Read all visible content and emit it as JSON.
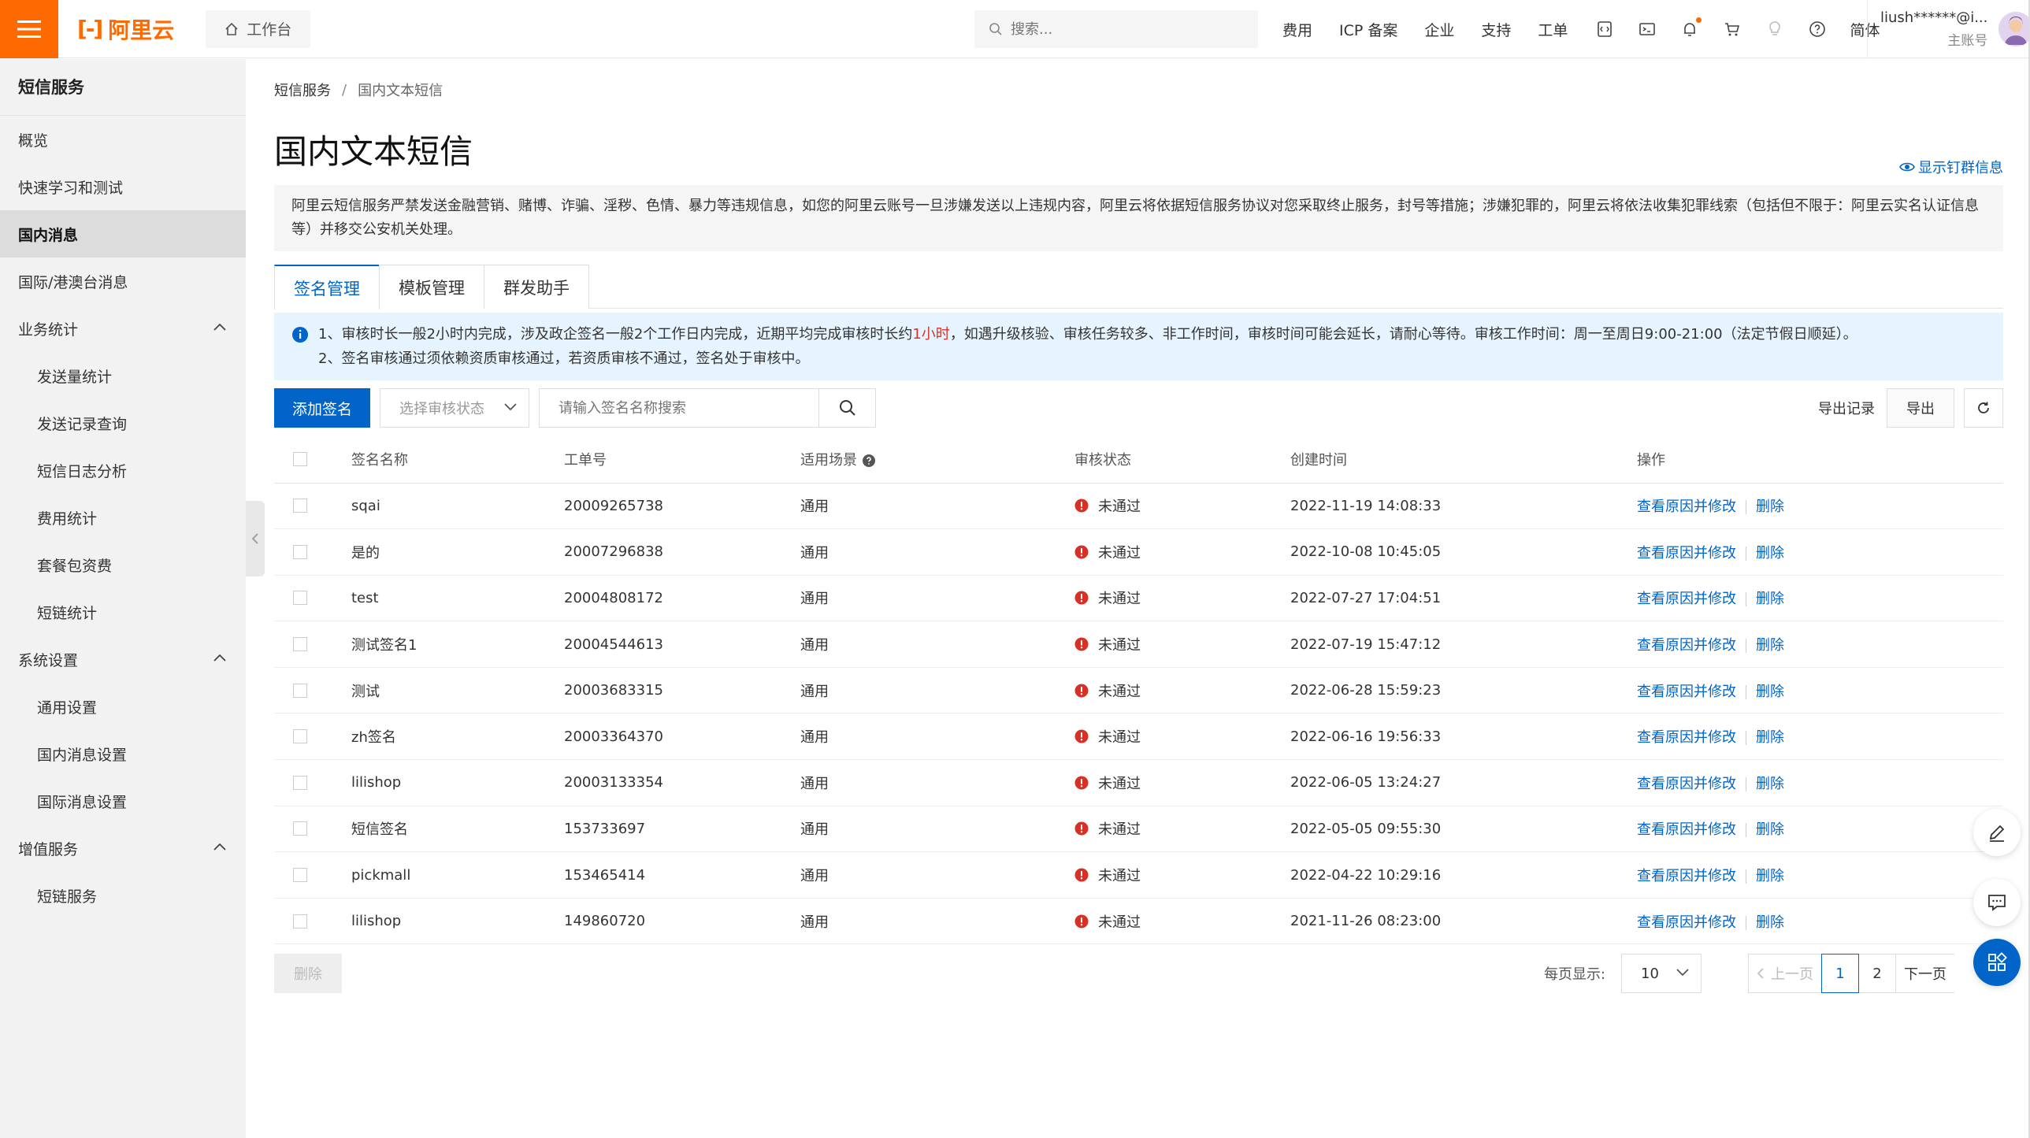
{
  "topbar": {
    "logo_text": "阿里云",
    "workbench": "工作台",
    "search_placeholder": "搜索...",
    "nav": [
      "费用",
      "ICP 备案",
      "企业",
      "支持",
      "工单"
    ],
    "lang": "简体",
    "account_name": "liush******@i...",
    "account_type": "主账号"
  },
  "sidebar": {
    "title": "短信服务",
    "items": [
      {
        "label": "概览"
      },
      {
        "label": "快速学习和测试"
      },
      {
        "label": "国内消息"
      },
      {
        "label": "国际/港澳台消息"
      },
      {
        "label": "业务统计"
      },
      {
        "label": "发送量统计"
      },
      {
        "label": "发送记录查询"
      },
      {
        "label": "短信日志分析"
      },
      {
        "label": "费用统计"
      },
      {
        "label": "套餐包资费"
      },
      {
        "label": "短链统计"
      },
      {
        "label": "系统设置"
      },
      {
        "label": "通用设置"
      },
      {
        "label": "国内消息设置"
      },
      {
        "label": "国际消息设置"
      },
      {
        "label": "增值服务"
      },
      {
        "label": "短链服务"
      }
    ]
  },
  "breadcrumb": {
    "root": "短信服务",
    "sep": "/",
    "current": "国内文本短信"
  },
  "page_title": "国内文本短信",
  "pin_link": "显示钉群信息",
  "warning": "阿里云短信服务严禁发送金融营销、赌博、诈骗、淫秽、色情、暴力等违规信息，如您的阿里云账号一旦涉嫌发送以上违规内容，阿里云将依据短信服务协议对您采取终止服务，封号等措施；涉嫌犯罪的，阿里云将依法收集犯罪线索（包括但不限于：阿里云实名认证信息等）并移交公安机关处理。",
  "tabs": [
    "签名管理",
    "模板管理",
    "群发助手"
  ],
  "notice": {
    "line1_a": "1、审核时长一般2小时内完成，涉及政企签名一般2个工作日内完成，近期平均完成审核时长约",
    "line1_red": "1小时",
    "line1_b": "，如遇升级核验、审核任务较多、非工作时间，审核时间可能会延长，请耐心等待。审核工作时间：周一至周日9:00-21:00（法定节假日顺延）。",
    "line2": "2、签名审核通过须依赖资质审核通过，若资质审核不通过，签名处于审核中。"
  },
  "toolbar": {
    "add": "添加签名",
    "status_placeholder": "选择审核状态",
    "search_placeholder": "请输入签名名称搜索",
    "export_records": "导出记录",
    "export": "导出"
  },
  "table": {
    "headers": [
      "签名名称",
      "工单号",
      "适用场景",
      "审核状态",
      "创建时间",
      "操作"
    ],
    "op_edit": "查看原因并修改",
    "op_delete": "删除",
    "rows": [
      {
        "name": "sqai",
        "no": "20009265738",
        "scene": "通用",
        "status": "未通过",
        "time": "2022-11-19 14:08:33"
      },
      {
        "name": "是的",
        "no": "20007296838",
        "scene": "通用",
        "status": "未通过",
        "time": "2022-10-08 10:45:05"
      },
      {
        "name": "test",
        "no": "20004808172",
        "scene": "通用",
        "status": "未通过",
        "time": "2022-07-27 17:04:51"
      },
      {
        "name": "测试签名1",
        "no": "20004544613",
        "scene": "通用",
        "status": "未通过",
        "time": "2022-07-19 15:47:12"
      },
      {
        "name": "测试",
        "no": "20003683315",
        "scene": "通用",
        "status": "未通过",
        "time": "2022-06-28 15:59:23"
      },
      {
        "name": "zh签名",
        "no": "20003364370",
        "scene": "通用",
        "status": "未通过",
        "time": "2022-06-16 19:56:33"
      },
      {
        "name": "lilishop",
        "no": "20003133354",
        "scene": "通用",
        "status": "未通过",
        "time": "2022-06-05 13:24:27"
      },
      {
        "name": "短信签名",
        "no": "153733697",
        "scene": "通用",
        "status": "未通过",
        "time": "2022-05-05 09:55:30"
      },
      {
        "name": "pickmall",
        "no": "153465414",
        "scene": "通用",
        "status": "未通过",
        "time": "2022-04-22 10:29:16"
      },
      {
        "name": "lilishop",
        "no": "149860720",
        "scene": "通用",
        "status": "未通过",
        "time": "2021-11-26 08:23:00"
      }
    ]
  },
  "footer": {
    "delete": "删除",
    "page_size_label": "每页显示:",
    "page_size": "10",
    "prev": "上一页",
    "pages": [
      "1",
      "2"
    ],
    "next": "下一页"
  },
  "colors": {
    "brand": "#ff6a00",
    "primary": "#0064c8",
    "error": "#d93026",
    "notice_bg": "#e6f4ff"
  }
}
